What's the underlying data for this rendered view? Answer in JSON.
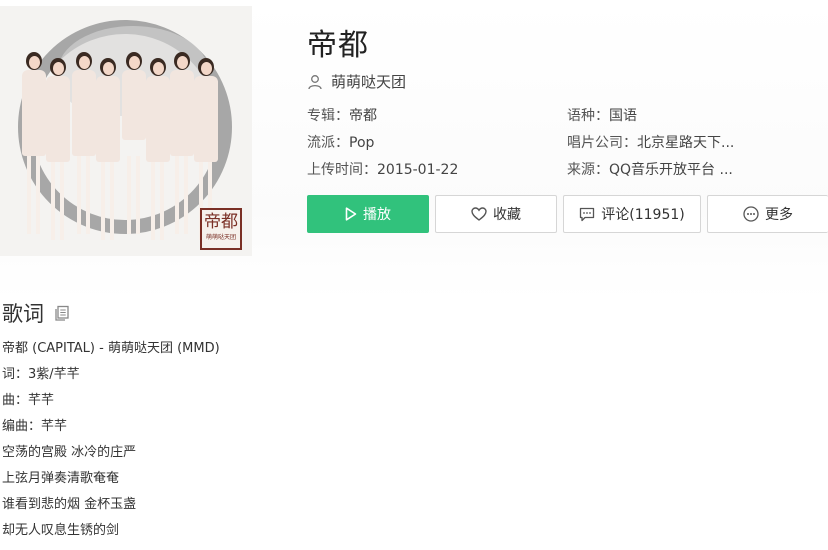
{
  "song": {
    "title": "帝都",
    "artist": "萌萌哒天团"
  },
  "cover": {
    "seal_text": "帝都",
    "seal_small": "萌萌哒天团"
  },
  "meta": {
    "album_label": "专辑：",
    "album": "帝都",
    "language_label": "语种：",
    "language": "国语",
    "genre_label": "流派：",
    "genre": "Pop",
    "label_label": "唱片公司：",
    "label": "北京星路天下...",
    "release_label": "上传时间：",
    "release": "2015-01-22",
    "source_label": "来源：",
    "source": "QQ音乐开放平台 ..."
  },
  "actions": {
    "play": "播放",
    "favorite": "收藏",
    "comment": "评论(11951)",
    "more": "更多"
  },
  "lyrics": {
    "heading": "歌词",
    "lines": [
      "帝都 (CAPITAL) - 萌萌哒天团 (MMD)",
      "词：3紫/芊芊",
      "曲：芊芊",
      "编曲：芊芊",
      "空荡的宫殿 冰冷的庄严",
      "上弦月弹奏清歌奄奄",
      "谁看到悲的烟 金杯玉盏",
      "却无人叹息生锈的剑"
    ]
  },
  "colors": {
    "accent": "#31c27c",
    "border": "#d6d6d6",
    "text": "#333333"
  },
  "icons": {
    "artist": "user-icon",
    "play": "play-icon",
    "favorite": "heart-icon",
    "comment": "comment-icon",
    "more": "more-dots-icon",
    "copy": "copy-icon"
  }
}
